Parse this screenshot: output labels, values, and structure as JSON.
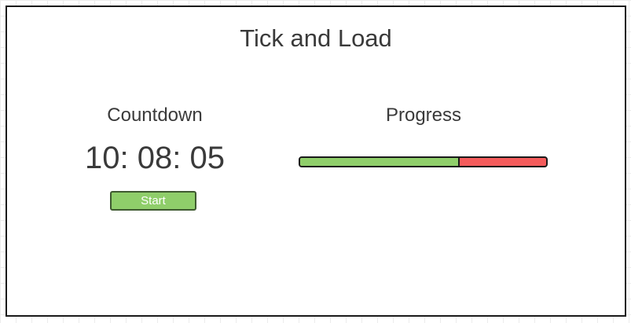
{
  "app": {
    "title": "Tick and Load"
  },
  "countdown": {
    "heading": "Countdown",
    "time": "10: 08: 05",
    "start_label": "Start"
  },
  "progress": {
    "heading": "Progress",
    "value": 0.65
  },
  "colors": {
    "progress_fill": "#8fce6a",
    "progress_remaining": "#f45b5b",
    "button_bg": "#8fce6a"
  }
}
